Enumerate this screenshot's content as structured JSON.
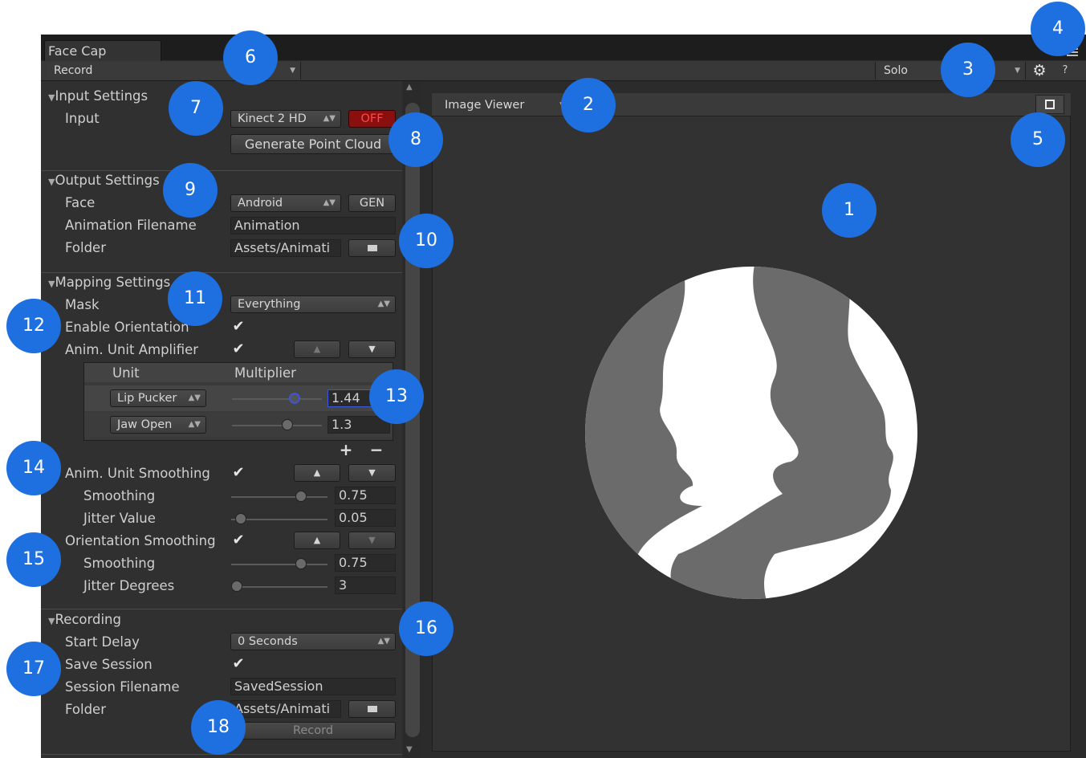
{
  "window": {
    "tab_title": "Face Cap"
  },
  "toolbar": {
    "mode": "Record",
    "solo": "Solo",
    "settings_icon": "gear-icon",
    "help": "?",
    "menu_icon": "menu-icon"
  },
  "input_settings": {
    "header": "Input Settings",
    "input_label": "Input",
    "input_device": "Kinect 2 HD",
    "toggle": "OFF",
    "generate_button": "Generate Point Cloud"
  },
  "output_settings": {
    "header": "Output Settings",
    "face_label": "Face",
    "face_value": "Android",
    "gen_button": "GEN",
    "anim_filename_label": "Animation Filename",
    "anim_filename_value": "Animation",
    "folder_label": "Folder",
    "folder_value": "Assets/Animati"
  },
  "mapping_settings": {
    "header": "Mapping Settings",
    "mask_label": "Mask",
    "mask_value": "Everything",
    "enable_orientation_label": "Enable Orientation",
    "enable_orientation": true,
    "amplifier_label": "Anim. Unit Amplifier",
    "amplifier": true,
    "table": {
      "col_unit": "Unit",
      "col_multiplier": "Multiplier",
      "rows": [
        {
          "unit": "Lip Pucker",
          "multiplier": "1.44",
          "level": 0.72
        },
        {
          "unit": "Jaw Open",
          "multiplier": "1.3",
          "level": 0.63
        }
      ],
      "add": "+",
      "remove": "−"
    },
    "smoothing_label": "Anim. Unit Smoothing",
    "smoothing_enabled": true,
    "smoothing_sub_label": "Smoothing",
    "smoothing_value": "0.75",
    "smoothing_level": 0.75,
    "jitter_label": "Jitter Value",
    "jitter_value": "0.05",
    "jitter_level": 0.05,
    "orient_smoothing_label": "Orientation Smoothing",
    "orient_smoothing_enabled": true,
    "orient_smoothing_sub_label": "Smoothing",
    "orient_smoothing_value": "0.75",
    "orient_smoothing_level": 0.75,
    "jitter_degrees_label": "Jitter Degrees",
    "jitter_degrees_value": "3",
    "jitter_degrees_level": 0.0
  },
  "recording": {
    "header": "Recording",
    "start_delay_label": "Start Delay",
    "start_delay_value": "0 Seconds",
    "save_session_label": "Save Session",
    "save_session": true,
    "session_filename_label": "Session Filename",
    "session_filename_value": "SavedSession",
    "folder_label": "Folder",
    "folder_value": "Assets/Animati",
    "record_button": "Record"
  },
  "viewer": {
    "title": "Image Viewer",
    "maximize_icon": "maximize-icon"
  },
  "callouts": [
    "1",
    "2",
    "3",
    "4",
    "5",
    "6",
    "7",
    "8",
    "9",
    "10",
    "11",
    "12",
    "13",
    "14",
    "15",
    "16",
    "17",
    "18"
  ],
  "colors": {
    "callout": "#1e6fe0",
    "off_toggle": "#8a0f0f",
    "panel": "#303030"
  }
}
